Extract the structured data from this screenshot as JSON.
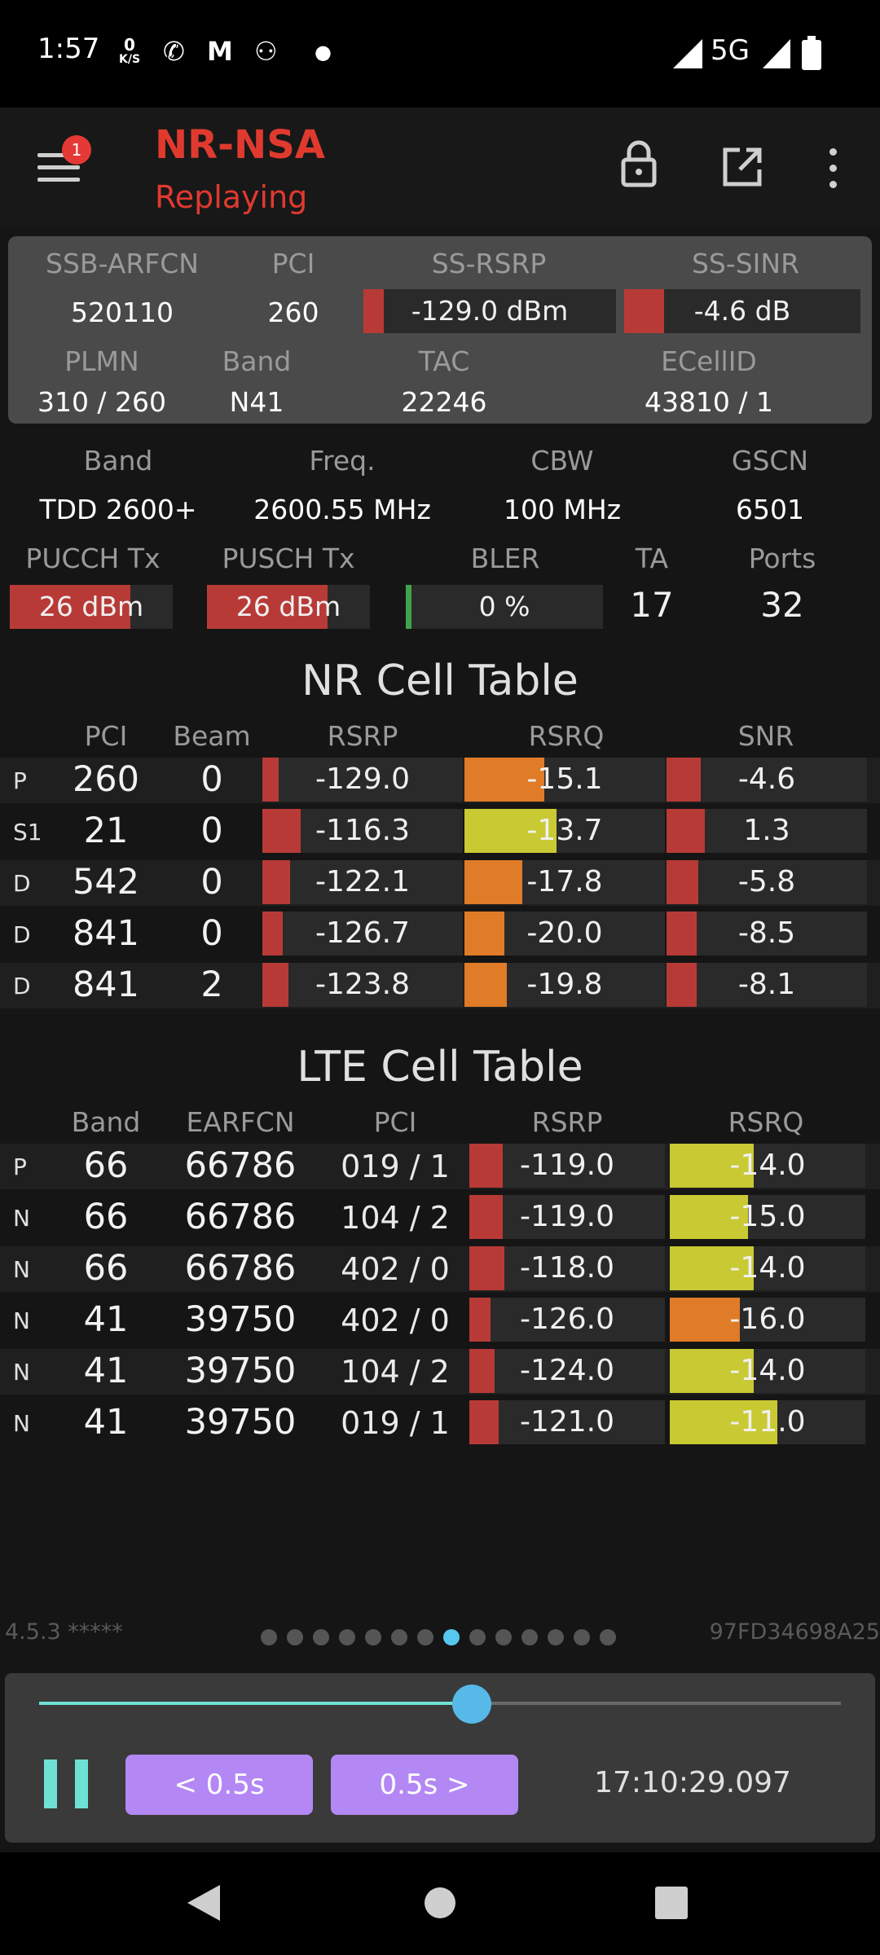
{
  "status_bar": {
    "time": "1:57",
    "net_speed_top": "0",
    "net_speed_bottom": "K/S",
    "network": "5G",
    "icons": [
      "wifi-calling-icon",
      "gmail-icon",
      "app-notification-icon",
      "dot-icon",
      "signal-icon",
      "battery-icon"
    ]
  },
  "app_bar": {
    "badge": "1",
    "title": "NR-NSA",
    "subtitle": "Replaying",
    "title_color": "#e03a2f"
  },
  "serving_cell": {
    "headers": {
      "arfcn": "SSB-ARFCN",
      "pci": "PCI",
      "rsrp": "SS-RSRP",
      "sinr": "SS-SINR"
    },
    "values": {
      "arfcn": "520110",
      "pci": "260",
      "rsrp": "-129.0 dBm",
      "sinr": "-4.6 dB"
    },
    "rsrp_level": 0.08,
    "sinr_level": 0.17,
    "headers2": {
      "plmn": "PLMN",
      "band": "Band",
      "tac": "TAC",
      "ecellid": "ECellID"
    },
    "values2": {
      "plmn": "310 / 260",
      "band": "N41",
      "tac": "22246",
      "ecellid": "43810 / 1"
    }
  },
  "nr_info": {
    "headers": {
      "band": "Band",
      "freq": "Freq.",
      "cbw": "CBW",
      "gscn": "GSCN"
    },
    "values": {
      "band": "TDD 2600+",
      "freq": "2600.55 MHz",
      "cbw": "100 MHz",
      "gscn": "6501"
    },
    "headers2": {
      "pucch": "PUCCH Tx",
      "pusch": "PUSCH Tx",
      "bler": "BLER",
      "ta": "TA",
      "ports": "Ports"
    },
    "values2": {
      "pucch": "26 dBm",
      "pusch": "26 dBm",
      "bler": "0 %",
      "ta": "17",
      "ports": "32"
    },
    "pucch_level": 0.74,
    "pusch_level": 0.74,
    "bler_level": 0.03
  },
  "nr_table": {
    "title": "NR Cell Table",
    "headers": {
      "pci": "PCI",
      "beam": "Beam",
      "rsrp": "RSRP",
      "rsrq": "RSRQ",
      "snr": "SNR"
    },
    "rows": [
      {
        "tag": "P",
        "pci": "260",
        "beam": "0",
        "rsrp": "-129.0",
        "rsrq": "-15.1",
        "snr": "-4.6",
        "rsrp_level": 0.08,
        "rsrq_level": 0.4,
        "snr_level": 0.17,
        "rsrq_color": "#e07b27"
      },
      {
        "tag": "S1",
        "pci": "21",
        "beam": "0",
        "rsrp": "-116.3",
        "rsrq": "-13.7",
        "snr": "1.3",
        "rsrp_level": 0.19,
        "rsrq_level": 0.46,
        "snr_level": 0.19,
        "rsrq_color": "#c9c934"
      },
      {
        "tag": "D",
        "pci": "542",
        "beam": "0",
        "rsrp": "-122.1",
        "rsrq": "-17.8",
        "snr": "-5.8",
        "rsrp_level": 0.14,
        "rsrq_level": 0.29,
        "snr_level": 0.16,
        "rsrq_color": "#e07b27"
      },
      {
        "tag": "D",
        "pci": "841",
        "beam": "0",
        "rsrp": "-126.7",
        "rsrq": "-20.0",
        "snr": "-8.5",
        "rsrp_level": 0.1,
        "rsrq_level": 0.2,
        "snr_level": 0.15,
        "rsrq_color": "#e07b27"
      },
      {
        "tag": "D",
        "pci": "841",
        "beam": "2",
        "rsrp": "-123.8",
        "rsrq": "-19.8",
        "snr": "-8.1",
        "rsrp_level": 0.13,
        "rsrq_level": 0.21,
        "snr_level": 0.15,
        "rsrq_color": "#e07b27"
      }
    ]
  },
  "lte_table": {
    "title": "LTE Cell Table",
    "headers": {
      "band": "Band",
      "earfcn": "EARFCN",
      "pci": "PCI",
      "rsrp": "RSRP",
      "rsrq": "RSRQ"
    },
    "rows": [
      {
        "tag": "P",
        "band": "66",
        "earfcn": "66786",
        "pci": "019 / 1",
        "rsrp": "-119.0",
        "rsrq": "-14.0",
        "rsrp_level": 0.17,
        "rsrq_level": 0.43,
        "rsrq_color": "#c9c934"
      },
      {
        "tag": "N",
        "band": "66",
        "earfcn": "66786",
        "pci": "104 / 2",
        "rsrp": "-119.0",
        "rsrq": "-15.0",
        "rsrp_level": 0.17,
        "rsrq_level": 0.4,
        "rsrq_color": "#c9c934"
      },
      {
        "tag": "N",
        "band": "66",
        "earfcn": "66786",
        "pci": "402 / 0",
        "rsrp": "-118.0",
        "rsrq": "-14.0",
        "rsrp_level": 0.18,
        "rsrq_level": 0.43,
        "rsrq_color": "#c9c934"
      },
      {
        "tag": "N",
        "band": "41",
        "earfcn": "39750",
        "pci": "402 / 0",
        "rsrp": "-126.0",
        "rsrq": "-16.0",
        "rsrp_level": 0.11,
        "rsrq_level": 0.36,
        "rsrq_color": "#e07b27"
      },
      {
        "tag": "N",
        "band": "41",
        "earfcn": "39750",
        "pci": "104 / 2",
        "rsrp": "-124.0",
        "rsrq": "-14.0",
        "rsrp_level": 0.13,
        "rsrq_level": 0.43,
        "rsrq_color": "#c9c934"
      },
      {
        "tag": "N",
        "band": "41",
        "earfcn": "39750",
        "pci": "019 / 1",
        "rsrp": "-121.0",
        "rsrq": "-11.0",
        "rsrp_level": 0.15,
        "rsrq_level": 0.55,
        "rsrq_color": "#c9c934"
      }
    ]
  },
  "footer": {
    "version": "4.5.3 *****",
    "device_id": "97FD34698A25",
    "page_count": 14,
    "active_page": 7
  },
  "player": {
    "progress": 0.54,
    "back_label": "< 0.5s",
    "forward_label": "0.5s >",
    "timestamp": "17:10:29.097"
  },
  "colors": {
    "red_bar": "#b83a36",
    "green_bar": "#3fa34d",
    "accent": "#6ee0d4",
    "button": "#b388f5"
  }
}
